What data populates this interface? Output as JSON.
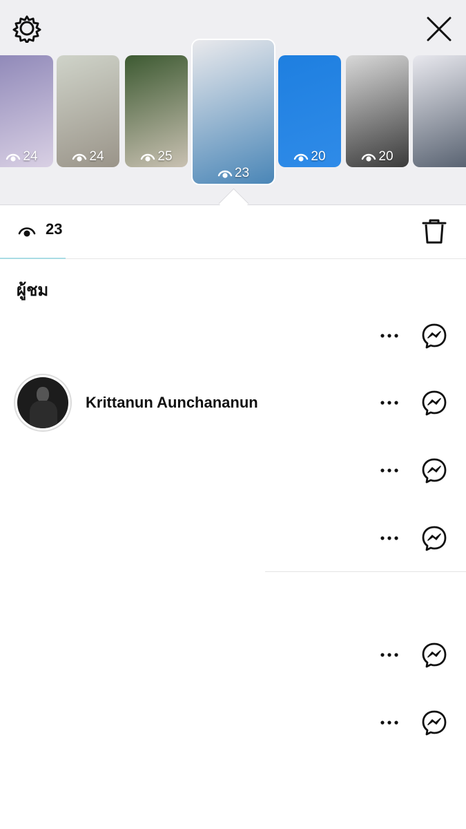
{
  "header": {
    "settings_icon": "settings-gear-icon",
    "close_icon": "close-x-icon"
  },
  "stories": [
    {
      "views": "24",
      "colors": [
        "#8f88b8",
        "#d9d0e4"
      ]
    },
    {
      "views": "24",
      "colors": [
        "#cfd3c9",
        "#9a9489"
      ]
    },
    {
      "views": "25",
      "colors": [
        "#3d5a32",
        "#c9c1b2"
      ]
    },
    {
      "views": "23",
      "colors": [
        "#e9e9ec",
        "#4a86b7"
      ],
      "selected": true
    },
    {
      "views": "20",
      "colors": [
        "#1e7fe0",
        "#2f8be8"
      ]
    },
    {
      "views": "20",
      "colors": [
        "#d8d8d8",
        "#3a3a3a"
      ]
    },
    {
      "views": "",
      "colors": [
        "#e8e8ee",
        "#56606f"
      ]
    }
  ],
  "stats": {
    "view_count": "23",
    "eye_icon": "eye-icon",
    "delete_icon": "trash-icon"
  },
  "viewers": {
    "heading": "ผู้ชม",
    "rows": [
      {
        "name": ""
      },
      {
        "name": "Krittanun Aunchananun"
      },
      {
        "name": ""
      },
      {
        "name": ""
      },
      {
        "name": ""
      },
      {
        "name": ""
      }
    ]
  },
  "accent_color": "#a9dce4"
}
